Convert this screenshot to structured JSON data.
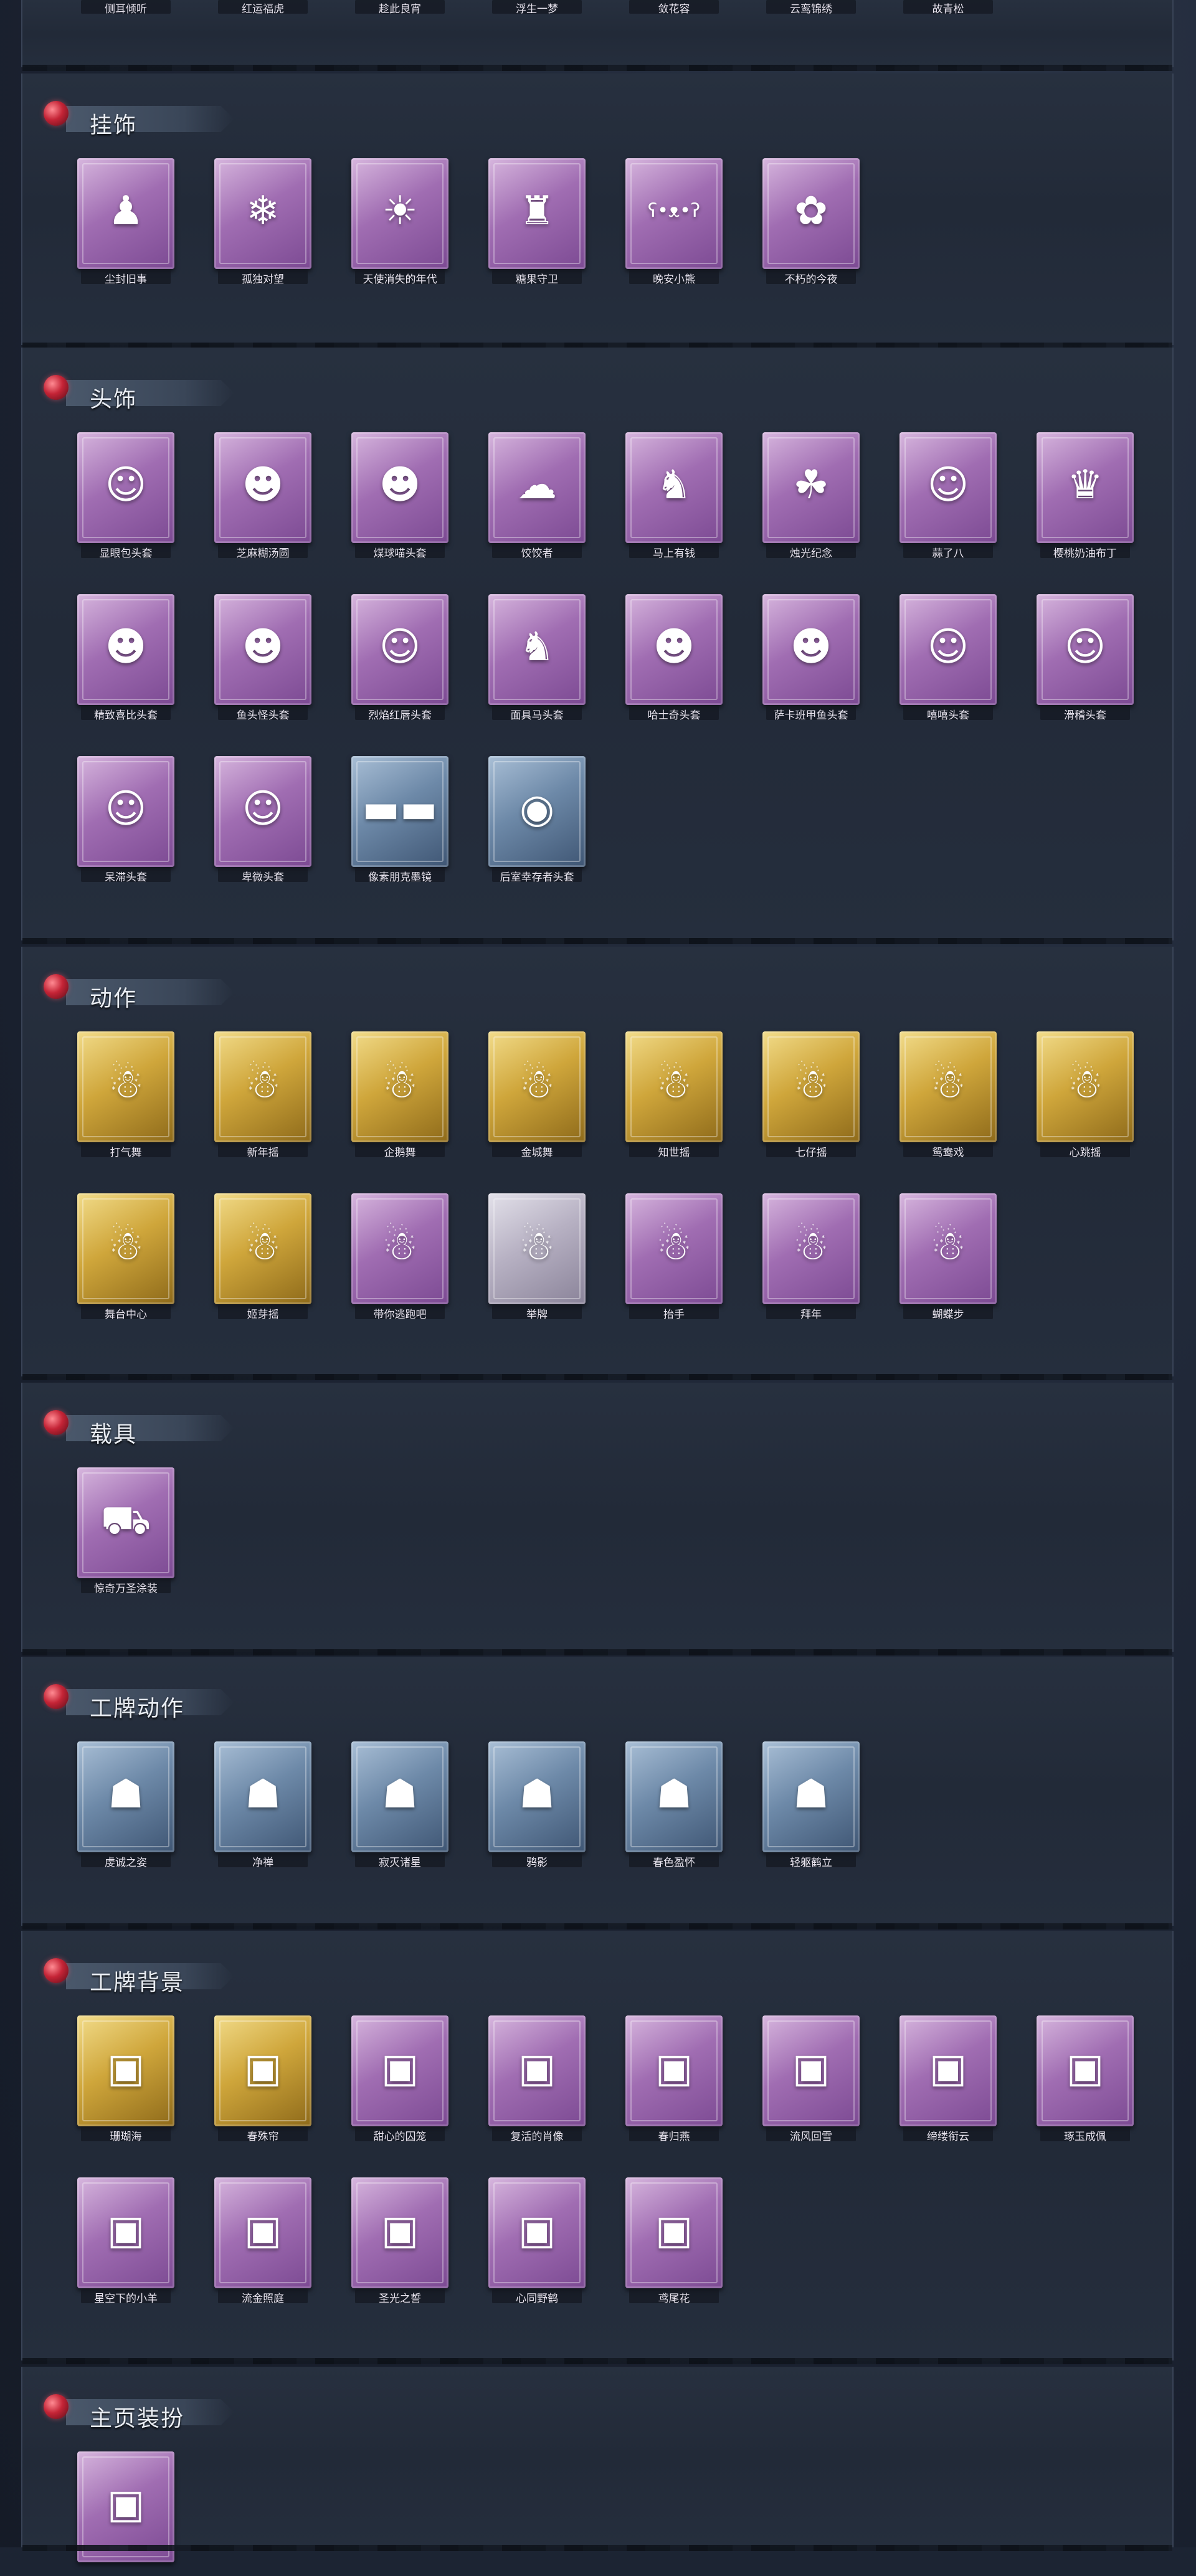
{
  "top_row": [
    "侧耳倾听",
    "红运福虎",
    "趁此良宵",
    "浮生一梦",
    "敛花容",
    "云鸾锦绣",
    "故青松"
  ],
  "sections": [
    {
      "title": "挂饰",
      "items": [
        {
          "label": "尘封旧事",
          "rarity": "purple",
          "icon": "figure-charm-icon",
          "glyph": "♟"
        },
        {
          "label": "孤独对望",
          "rarity": "purple",
          "icon": "crystal-charm-icon",
          "glyph": "❄"
        },
        {
          "label": "天使消失的年代",
          "rarity": "purple",
          "icon": "angel-charm-icon",
          "glyph": "☀"
        },
        {
          "label": "糖果守卫",
          "rarity": "purple",
          "icon": "candy-charm-icon",
          "glyph": "♜"
        },
        {
          "label": "晚安小熊",
          "rarity": "purple",
          "icon": "bear-charm-icon",
          "glyph": "ʕ•ᴥ•ʔ"
        },
        {
          "label": "不朽的今夜",
          "rarity": "purple",
          "icon": "pink-creature-charm-icon",
          "glyph": "✿"
        }
      ]
    },
    {
      "title": "头饰",
      "items": [
        {
          "label": "显眼包头套",
          "rarity": "purple",
          "icon": "crown-egg-head-icon",
          "glyph": "☺"
        },
        {
          "label": "芝麻糊汤圆",
          "rarity": "purple",
          "icon": "dumpling-head-icon",
          "glyph": "☻"
        },
        {
          "label": "煤球喵头套",
          "rarity": "purple",
          "icon": "cat-head-icon",
          "glyph": "☻"
        },
        {
          "label": "饺饺者",
          "rarity": "purple",
          "icon": "dumpling-cloud-icon",
          "glyph": "☁"
        },
        {
          "label": "马上有钱",
          "rarity": "purple",
          "icon": "horse-head-icon",
          "glyph": "♞"
        },
        {
          "label": "烛光纪念",
          "rarity": "purple",
          "icon": "candle-head-icon",
          "glyph": "☘"
        },
        {
          "label": "蒜了八",
          "rarity": "purple",
          "icon": "garlic-head-icon",
          "glyph": "☺"
        },
        {
          "label": "樱桃奶油布丁",
          "rarity": "purple",
          "icon": "pudding-head-icon",
          "glyph": "♛"
        },
        {
          "label": "精致喜比头套",
          "rarity": "purple",
          "icon": "pink-bear-head-icon",
          "glyph": "☻"
        },
        {
          "label": "鱼头怪头套",
          "rarity": "purple",
          "icon": "fish-head-icon",
          "glyph": "☻"
        },
        {
          "label": "烈焰红唇头套",
          "rarity": "purple",
          "icon": "yellow-creature-head-icon",
          "glyph": "☺"
        },
        {
          "label": "面具马头套",
          "rarity": "purple",
          "icon": "horse-mask-icon",
          "glyph": "♞"
        },
        {
          "label": "哈士奇头套",
          "rarity": "purple",
          "icon": "husky-head-icon",
          "glyph": "☻"
        },
        {
          "label": "萨卡班甲鱼头套",
          "rarity": "purple",
          "icon": "fish-blue-head-icon",
          "glyph": "☻"
        },
        {
          "label": "嘻嘻头套",
          "rarity": "purple",
          "icon": "grin-emoji-head-icon",
          "glyph": "☺"
        },
        {
          "label": "滑稽头套",
          "rarity": "purple",
          "icon": "smirk-emoji-head-icon",
          "glyph": "☺"
        },
        {
          "label": "呆滞头套",
          "rarity": "purple",
          "icon": "blank-emoji-head-icon",
          "glyph": "☺"
        },
        {
          "label": "卑微头套",
          "rarity": "purple",
          "icon": "shy-emoji-head-icon",
          "glyph": "☺"
        },
        {
          "label": "像素朋克墨镜",
          "rarity": "blue",
          "icon": "pixel-sunglasses-icon",
          "glyph": "▬▬"
        },
        {
          "label": "后室幸存者头套",
          "rarity": "blue",
          "icon": "gas-mask-icon",
          "glyph": "◉"
        }
      ]
    },
    {
      "title": "动作",
      "items": [
        {
          "label": "打气舞",
          "rarity": "gold",
          "icon": "pose-icon",
          "glyph": "☃"
        },
        {
          "label": "新年摇",
          "rarity": "gold",
          "icon": "pose-icon",
          "glyph": "☃"
        },
        {
          "label": "企鹅舞",
          "rarity": "gold",
          "icon": "pose-icon",
          "glyph": "☃"
        },
        {
          "label": "金城舞",
          "rarity": "gold",
          "icon": "pose-icon",
          "glyph": "☃"
        },
        {
          "label": "知世摇",
          "rarity": "gold",
          "icon": "pose-icon",
          "glyph": "☃"
        },
        {
          "label": "七仔摇",
          "rarity": "gold",
          "icon": "pose-icon",
          "glyph": "☃"
        },
        {
          "label": "鸳鸯戏",
          "rarity": "gold",
          "icon": "pose-icon",
          "glyph": "☃"
        },
        {
          "label": "心跳摇",
          "rarity": "gold",
          "icon": "pose-icon",
          "glyph": "☃"
        },
        {
          "label": "舞台中心",
          "rarity": "gold",
          "icon": "pose-icon",
          "glyph": "☃"
        },
        {
          "label": "姬芽摇",
          "rarity": "gold",
          "icon": "pose-icon",
          "glyph": "☃"
        },
        {
          "label": "带你逃跑吧",
          "rarity": "purple",
          "icon": "pose-icon",
          "glyph": "☃"
        },
        {
          "label": "举牌",
          "rarity": "white",
          "icon": "pose-icon",
          "glyph": "☃"
        },
        {
          "label": "抬手",
          "rarity": "purple",
          "icon": "pose-icon",
          "glyph": "☃"
        },
        {
          "label": "拜年",
          "rarity": "purple",
          "icon": "pose-icon",
          "glyph": "☃"
        },
        {
          "label": "蝴蝶步",
          "rarity": "purple",
          "icon": "pose-icon",
          "glyph": "☃"
        }
      ]
    },
    {
      "title": "载具",
      "items": [
        {
          "label": "惊奇万圣涂装",
          "rarity": "purple",
          "icon": "vehicle-truck-icon",
          "glyph": "⛟"
        }
      ]
    },
    {
      "title": "工牌动作",
      "items": [
        {
          "label": "虔诚之姿",
          "rarity": "blue",
          "icon": "badge-pose-icon",
          "glyph": "☗"
        },
        {
          "label": "净禅",
          "rarity": "blue",
          "icon": "badge-pose-icon",
          "glyph": "☗"
        },
        {
          "label": "寂灭诸星",
          "rarity": "blue",
          "icon": "badge-pose-icon",
          "glyph": "☗"
        },
        {
          "label": "鸦影",
          "rarity": "blue",
          "icon": "badge-pose-icon",
          "glyph": "☗"
        },
        {
          "label": "春色盈怀",
          "rarity": "blue",
          "icon": "badge-pose-icon",
          "glyph": "☗"
        },
        {
          "label": "轻躯鹤立",
          "rarity": "blue",
          "icon": "badge-pose-icon",
          "glyph": "☗"
        }
      ]
    },
    {
      "title": "工牌背景",
      "items": [
        {
          "label": "珊瑚海",
          "rarity": "gold",
          "icon": "badge-background-icon",
          "glyph": "▣"
        },
        {
          "label": "春殊帘",
          "rarity": "gold",
          "icon": "badge-background-icon",
          "glyph": "▣"
        },
        {
          "label": "甜心的囚笼",
          "rarity": "purple",
          "icon": "badge-background-icon",
          "glyph": "▣"
        },
        {
          "label": "复活的肖像",
          "rarity": "purple",
          "icon": "badge-background-icon",
          "glyph": "▣"
        },
        {
          "label": "春归燕",
          "rarity": "purple",
          "icon": "badge-background-icon",
          "glyph": "▣"
        },
        {
          "label": "流风回雪",
          "rarity": "purple",
          "icon": "badge-background-icon",
          "glyph": "▣"
        },
        {
          "label": "缔缕衔云",
          "rarity": "purple",
          "icon": "badge-background-icon",
          "glyph": "▣"
        },
        {
          "label": "琢玉成佩",
          "rarity": "purple",
          "icon": "badge-background-icon",
          "glyph": "▣"
        },
        {
          "label": "星空下的小羊",
          "rarity": "purple",
          "icon": "badge-background-icon",
          "glyph": "▣"
        },
        {
          "label": "流金照庭",
          "rarity": "purple",
          "icon": "badge-background-icon",
          "glyph": "▣"
        },
        {
          "label": "圣光之誓",
          "rarity": "purple",
          "icon": "badge-background-icon",
          "glyph": "▣"
        },
        {
          "label": "心同野鹤",
          "rarity": "purple",
          "icon": "badge-background-icon",
          "glyph": "▣"
        },
        {
          "label": "鸢尾花",
          "rarity": "purple",
          "icon": "badge-background-icon",
          "glyph": "▣"
        }
      ]
    },
    {
      "title": "主页装扮",
      "items": [
        {
          "label": "",
          "rarity": "purple",
          "icon": "homepage-decoration-icon",
          "glyph": "▣"
        }
      ]
    }
  ]
}
